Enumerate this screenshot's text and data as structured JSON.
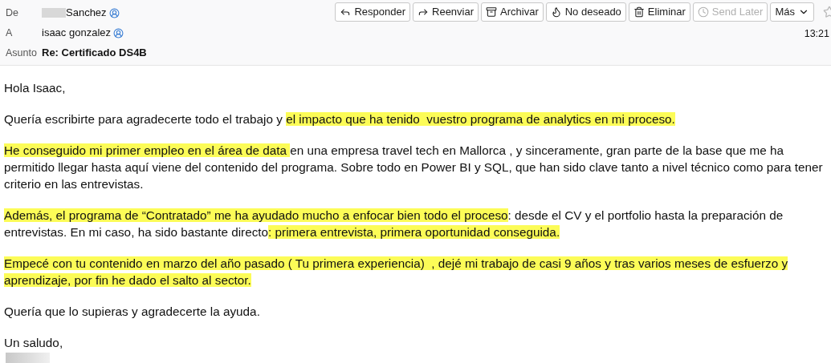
{
  "header": {
    "fields": [
      {
        "label": "De",
        "value": "Sanchez",
        "redacted": true,
        "contact_icon": true,
        "bold": false
      },
      {
        "label": "A",
        "value": "isaac gonzalez",
        "redacted": false,
        "contact_icon": true,
        "bold": false
      },
      {
        "label": "Asunto",
        "value": "Re: Certificado DS4B",
        "redacted": false,
        "contact_icon": false,
        "bold": true
      }
    ],
    "time": "13:21",
    "buttons": [
      {
        "kind": "reply",
        "label": "Responder",
        "disabled": false
      },
      {
        "kind": "forward",
        "label": "Reenviar",
        "disabled": false
      },
      {
        "kind": "archive",
        "label": "Archivar",
        "disabled": false
      },
      {
        "kind": "junk",
        "label": "No deseado",
        "disabled": false
      },
      {
        "kind": "delete",
        "label": "Eliminar",
        "disabled": false
      },
      {
        "kind": "clock",
        "label": "Send Later",
        "disabled": true
      },
      {
        "kind": "more",
        "label": "Más",
        "disabled": false
      }
    ]
  },
  "body": {
    "paragraphs": [
      {
        "lines": [
          [
            {
              "text": "Hola Isaac,",
              "highlighted": false
            }
          ]
        ]
      },
      {
        "lines": [
          [
            {
              "text": "Quería escribirte para agradecerte todo el trabajo y ",
              "highlighted": false
            },
            {
              "text": "el impacto que ha tenido  vuestro programa de analytics en mi proceso.",
              "highlighted": true
            }
          ]
        ]
      },
      {
        "lines": [
          [
            {
              "text": "He conseguido mi primer empleo en el área de data ",
              "highlighted": true
            },
            {
              "text": "en una empresa travel tech en Mallorca , y sinceramente, gran parte de la base que me ha",
              "highlighted": false
            }
          ],
          [
            {
              "text": "permitido llegar hasta aquí viene del contenido del programa. Sobre todo en Power BI y SQL, que han sido clave tanto a nivel técnico como para tener",
              "highlighted": false
            }
          ],
          [
            {
              "text": "criterio en las entrevistas.",
              "highlighted": false
            }
          ]
        ]
      },
      {
        "lines": [
          [
            {
              "text": "Además, el programa de “Contratado” me ha ayudado mucho a enfocar bien todo el proceso",
              "highlighted": true
            },
            {
              "text": ": desde el CV y el portfolio hasta la preparación de",
              "highlighted": false
            }
          ],
          [
            {
              "text": "entrevistas. En mi caso, ha sido bastante directo",
              "highlighted": false
            },
            {
              "text": ": primera entrevista, primera oportunidad conseguida.",
              "highlighted": true
            }
          ]
        ]
      },
      {
        "lines": [
          [
            {
              "text": "Empecé con tu contenido en marzo del año pasado ( Tu primera experiencia)  , dejé mi trabajo de casi 9 años y tras varios meses de esfuerzo y",
              "highlighted": true
            }
          ],
          [
            {
              "text": "aprendizaje, por fin he dado el salto al sector.",
              "highlighted": true
            }
          ]
        ]
      },
      {
        "lines": [
          [
            {
              "text": "Quería que lo supieras y agradecerte la ayuda.",
              "highlighted": false
            }
          ]
        ]
      },
      {
        "lines": [
          [
            {
              "text": "Un saludo,",
              "highlighted": false
            }
          ]
        ]
      }
    ],
    "signature_redacted": true
  }
}
